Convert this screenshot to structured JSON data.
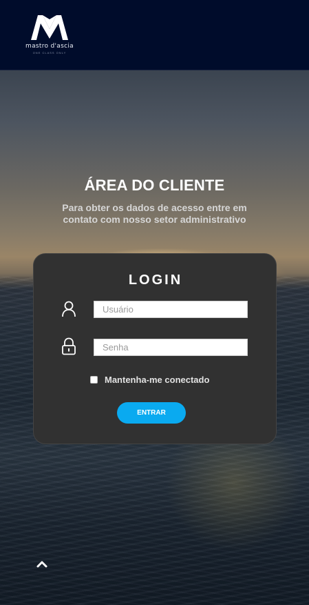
{
  "header": {
    "logo_name": "mastro d'ascia",
    "logo_tagline": "ONE CLASS ONLY"
  },
  "hero": {
    "title": "ÁREA DO CLIENTE",
    "subtitle": "Para obter os dados de acesso entre em contato com nosso setor administrativo"
  },
  "login": {
    "title": "LOGIN",
    "username": {
      "placeholder": "Usuário",
      "value": "",
      "icon": "user-icon"
    },
    "password": {
      "placeholder": "Senha",
      "value": "",
      "icon": "lock-icon"
    },
    "remember_label": "Mantenha-me conectado",
    "remember_checked": false,
    "submit_label": "ENTRAR"
  },
  "scroll_top": {
    "icon": "chevron-up-icon"
  },
  "colors": {
    "header_bg": "#000c2b",
    "card_bg": "#313131",
    "accent": "#0aaaf0"
  }
}
